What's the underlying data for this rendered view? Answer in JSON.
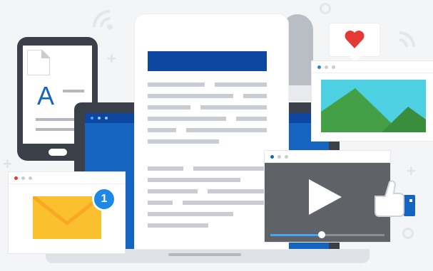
{
  "colors": {
    "background": "#f4f5f7",
    "device_dark": "#3a3f48",
    "brand_blue": "#1565c0",
    "dark_blue": "#0d47a1",
    "envelope_yellow": "#fbc02d",
    "heart_red": "#e53935",
    "sky_cyan": "#4dd0e1",
    "mountain_green": "#43a047",
    "video_gray": "#5f6368"
  },
  "phone": {
    "letter": "A",
    "icon": "text-document-icon"
  },
  "mail": {
    "icon": "envelope-icon",
    "badge_count": "1"
  },
  "video": {
    "icon": "play-icon",
    "progress": 0.45
  },
  "image_window": {
    "icon": "landscape-image-icon"
  },
  "social": {
    "like_icon": "thumbs-up-icon",
    "heart_icon": "heart-icon",
    "wifi_icon": "wifi-signal-icon"
  }
}
